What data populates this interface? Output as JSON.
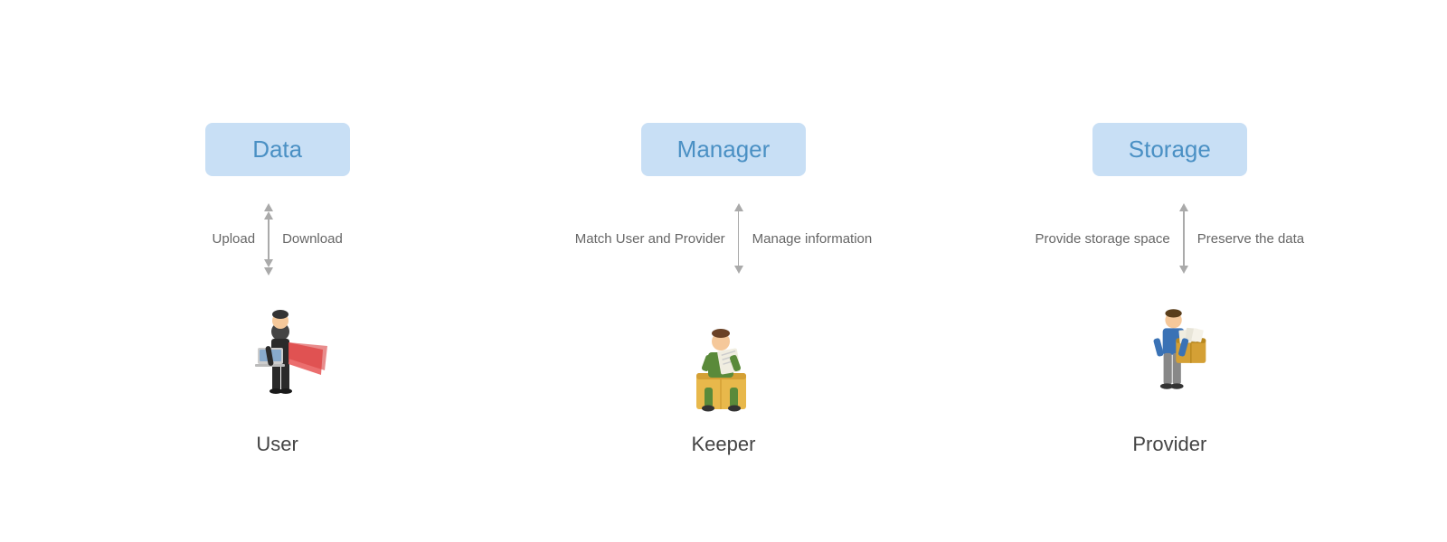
{
  "columns": [
    {
      "id": "data",
      "badge": "Data",
      "arrow_label_left": "Upload",
      "arrow_label_right": "Download",
      "figure_label": "User"
    },
    {
      "id": "manager",
      "badge": "Manager",
      "arrow_label_left": "Match User and Provider",
      "arrow_label_right": "Manage information",
      "figure_label": "Keeper"
    },
    {
      "id": "storage",
      "badge": "Storage",
      "arrow_label_left": "Provide storage space",
      "arrow_label_right": "Preserve the data",
      "figure_label": "Provider"
    }
  ]
}
